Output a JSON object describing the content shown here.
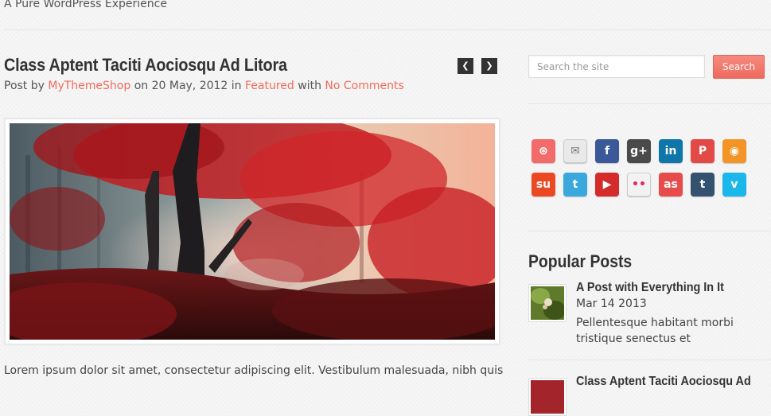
{
  "header": {
    "tagline": "A Pure WordPress Experience"
  },
  "post": {
    "title": "Class Aptent Taciti Aociosqu Ad Litora",
    "meta_prefix": "Post by ",
    "author": "MyThemeShop",
    "meta_on": " on ",
    "date": "20 May, 2012",
    "meta_in": " in ",
    "category": "Featured",
    "meta_with": " with ",
    "comments": "No Comments",
    "excerpt": "Lorem ipsum dolor sit amet, consectetur adipiscing elit. Vestibulum malesuada, nibh quis"
  },
  "post_nav": {
    "prev_label": "❮",
    "next_label": "❯"
  },
  "search": {
    "placeholder": "Search the site",
    "button_label": "Search"
  },
  "social": {
    "icons": [
      {
        "name": "dribbble",
        "glyph": "⊛",
        "color": "#f26a6a"
      },
      {
        "name": "email",
        "glyph": "✉",
        "color": "#e9e9e9"
      },
      {
        "name": "facebook",
        "glyph": "f",
        "color": "#3b5998"
      },
      {
        "name": "google-plus",
        "glyph": "g+",
        "color": "#4a4a4a"
      },
      {
        "name": "linkedin",
        "glyph": "in",
        "color": "#0e76a8"
      },
      {
        "name": "pinterest",
        "glyph": "P",
        "color": "#e34a46"
      },
      {
        "name": "rss",
        "glyph": "◉",
        "color": "#f39426"
      },
      {
        "name": "stumbleupon",
        "glyph": "su",
        "color": "#eb4924"
      },
      {
        "name": "twitter",
        "glyph": "t",
        "color": "#3aa8dd"
      },
      {
        "name": "youtube",
        "glyph": "▶",
        "color": "#d42b2b"
      },
      {
        "name": "flickr",
        "glyph": "••",
        "color": "#f2f2f2"
      },
      {
        "name": "lastfm",
        "glyph": "as",
        "color": "#e84b4b"
      },
      {
        "name": "tumblr",
        "glyph": "t",
        "color": "#34526f"
      },
      {
        "name": "vimeo",
        "glyph": "v",
        "color": "#1ab7ea"
      }
    ]
  },
  "popular": {
    "title": "Popular Posts",
    "items": [
      {
        "title": "A Post with Everything In It",
        "date": "Mar 14 2013",
        "excerpt": "Pellentesque habitant morbi tristique senectus et"
      },
      {
        "title": "Class Aptent Taciti Aociosqu Ad",
        "date": "",
        "excerpt": ""
      }
    ]
  }
}
